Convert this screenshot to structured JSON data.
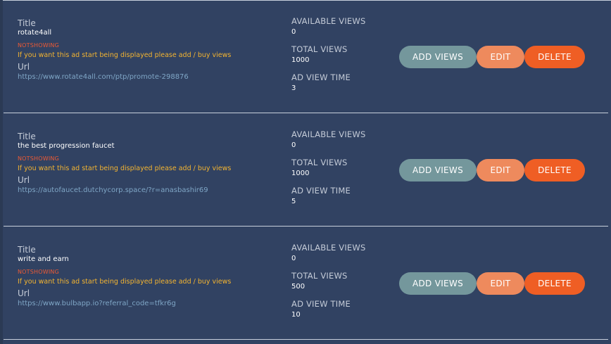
{
  "labels": {
    "title": "Title",
    "url": "Url",
    "available_views": "AVAILABLE VIEWS",
    "total_views": "TOTAL VIEWS",
    "ad_view_time": "AD VIEW TIME"
  },
  "buttons": {
    "add_views": "ADD VIEWS",
    "edit": "EDIT",
    "delete": "DELETE"
  },
  "ads": [
    {
      "title": "rotate4all",
      "status": "NOTSHOWING",
      "warning": "If you want this ad start being displayed please add / buy views",
      "url": "https://www.rotate4all.com/ptp/promote-298876",
      "available_views": "0",
      "total_views": "1000",
      "ad_view_time": "3"
    },
    {
      "title": "the best progression faucet",
      "status": "NOTSHOWING",
      "warning": "If you want this ad start being displayed please add / buy views",
      "url": "https://autofaucet.dutchycorp.space/?r=anasbashir69",
      "available_views": "0",
      "total_views": "1000",
      "ad_view_time": "5"
    },
    {
      "title": "write and earn",
      "status": "NOTSHOWING",
      "warning": "If you want this ad start being displayed please add / buy views",
      "url": "https://www.bulbapp.io?referral_code=tfkr6g",
      "available_views": "0",
      "total_views": "500",
      "ad_view_time": "10"
    }
  ],
  "colors": {
    "background": "#314262",
    "add_views_button": "#74979c",
    "edit_button": "#ee8a5d",
    "delete_button": "#ef5e24",
    "status_text": "#ee5a34",
    "warning_text": "#f3b431",
    "url_text": "#7fa6c6"
  }
}
